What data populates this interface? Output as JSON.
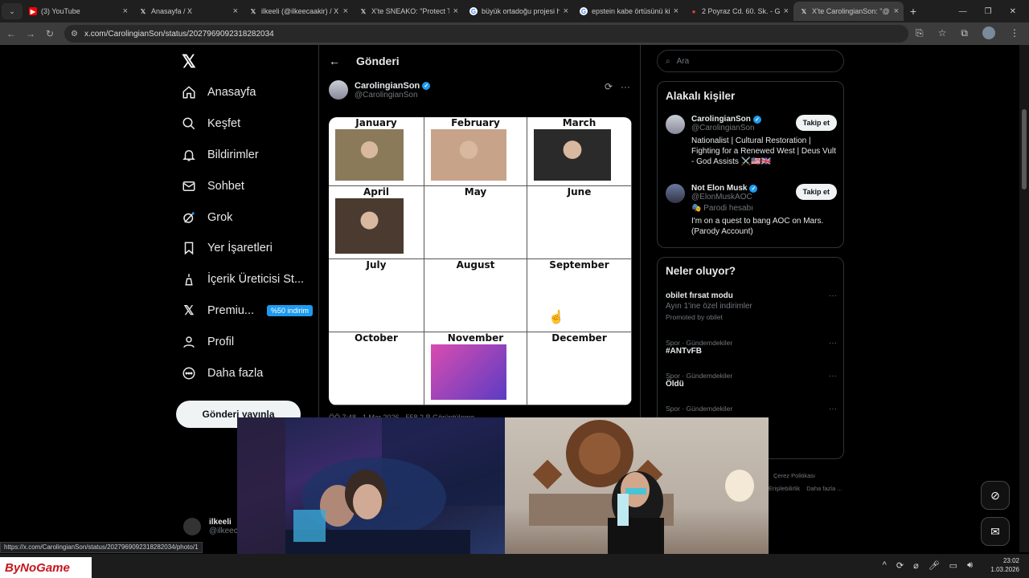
{
  "browser": {
    "tabs": [
      {
        "title": "(3) YouTube",
        "icon": "youtube-icon"
      },
      {
        "title": "Anasayfa / X",
        "icon": "x-icon"
      },
      {
        "title": "ilkeeli (@ilkeecaakir) / X",
        "icon": "x-icon"
      },
      {
        "title": "X'te SNEAKO: \"Protect Tu",
        "icon": "x-icon"
      },
      {
        "title": "büyük ortadoğu projesi h",
        "icon": "google-icon"
      },
      {
        "title": "epstein kabe örtüsünü kir",
        "icon": "google-icon"
      },
      {
        "title": "2 Poyraz Cd. 60. Sk. - Goo",
        "icon": "maps-icon"
      },
      {
        "title": "X'te CarolingianSon: \"@E",
        "icon": "x-icon"
      }
    ],
    "url": "x.com/CarolingianSon/status/2027969092318282034",
    "status_url": "https://x.com/CarolingianSon/status/2027969092318282034/photo/1"
  },
  "sidebar": {
    "items": [
      {
        "label": "Anasayfa",
        "icon": "home-icon"
      },
      {
        "label": "Keşfet",
        "icon": "search-icon"
      },
      {
        "label": "Bildirimler",
        "icon": "bell-icon"
      },
      {
        "label": "Sohbet",
        "icon": "mail-icon"
      },
      {
        "label": "Grok",
        "icon": "grok-icon"
      },
      {
        "label": "Yer İşaretleri",
        "icon": "bookmark-icon"
      },
      {
        "label": "İçerik Üreticisi St...",
        "icon": "creator-icon"
      },
      {
        "label": "Premiu...",
        "icon": "x-premium-icon",
        "badge": "%50 indirim"
      },
      {
        "label": "Profil",
        "icon": "person-icon"
      },
      {
        "label": "Daha fazla",
        "icon": "more-circle-icon"
      }
    ],
    "post_button": "Gönderi yayınla",
    "account": {
      "name": "ilkeeli",
      "handle": "@ilkeec"
    }
  },
  "post": {
    "header_title": "Gönderi",
    "author_name": "CarolingianSon",
    "author_handle": "@CarolingianSon",
    "months": [
      "January",
      "February",
      "March",
      "April",
      "May",
      "June",
      "July",
      "August",
      "September",
      "October",
      "November",
      "December"
    ],
    "footer": "ÖÖ 7:48 · 1 Mar 2026 · 558,2 B Görüntüleme"
  },
  "right": {
    "search_placeholder": "Ara",
    "people_title": "Alakalı kişiler",
    "people": [
      {
        "name": "CarolingianSon",
        "handle": "@CarolingianSon",
        "bio": "Nationalist | Cultural Restoration | Fighting for a Renewed West | Deus Vult - God Assists ⚔️🇺🇸🇬🇧",
        "follow": "Takip et"
      },
      {
        "name": "Not Elon Musk",
        "handle": "@ElonMuskAOC",
        "parody": "Parodi hesabı",
        "bio": "I'm on a quest to bang AOC on Mars. (Parody Account)",
        "follow": "Takip et"
      }
    ],
    "trends_title": "Neler oluyor?",
    "trends": [
      {
        "category": "",
        "title": "obilet fırsat modu",
        "subtitle": "Ayın 1'ine özel indirimler",
        "promo": "Promoted by obilet"
      },
      {
        "category": "Spor · Gündemdekiler",
        "title": "#ANTvFB"
      },
      {
        "category": "Spor · Gündemdekiler",
        "title": "Öldü"
      },
      {
        "category": "Spor · Gündemdekiler",
        "title": ""
      }
    ],
    "footer_links": [
      "Çerez Politikası",
      "Erişilebilirlik",
      "Daha fazla ..."
    ]
  },
  "taskbar": {
    "overlay_logo": "ByNoGame",
    "time": "23:02",
    "date": "1.03.2026"
  },
  "colors": {
    "accent": "#1d9bf0",
    "background": "#000000",
    "border": "#2f3336"
  }
}
